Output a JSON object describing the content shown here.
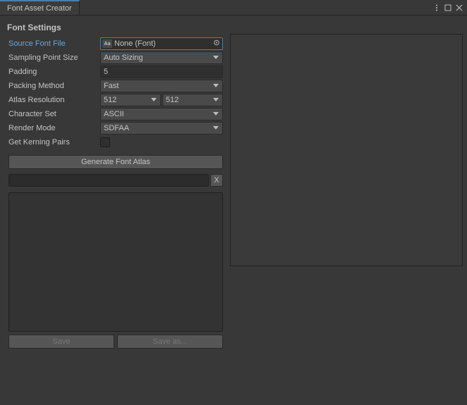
{
  "window": {
    "tab_title": "Font Asset Creator"
  },
  "section_header": "Font Settings",
  "form": {
    "source_font_label": "Source Font File",
    "source_font_value": "None (Font)",
    "sampling_label": "Sampling Point Size",
    "sampling_value": "Auto Sizing",
    "padding_label": "Padding",
    "padding_value": "5",
    "packing_label": "Packing Method",
    "packing_value": "Fast",
    "atlas_label": "Atlas Resolution",
    "atlas_w": "512",
    "atlas_h": "512",
    "charset_label": "Character Set",
    "charset_value": "ASCII",
    "render_label": "Render Mode",
    "render_value": "SDFAA",
    "kerning_label": "Get Kerning Pairs"
  },
  "buttons": {
    "generate": "Generate Font Atlas",
    "clear": "X",
    "save": "Save",
    "save_as": "Save as..."
  }
}
